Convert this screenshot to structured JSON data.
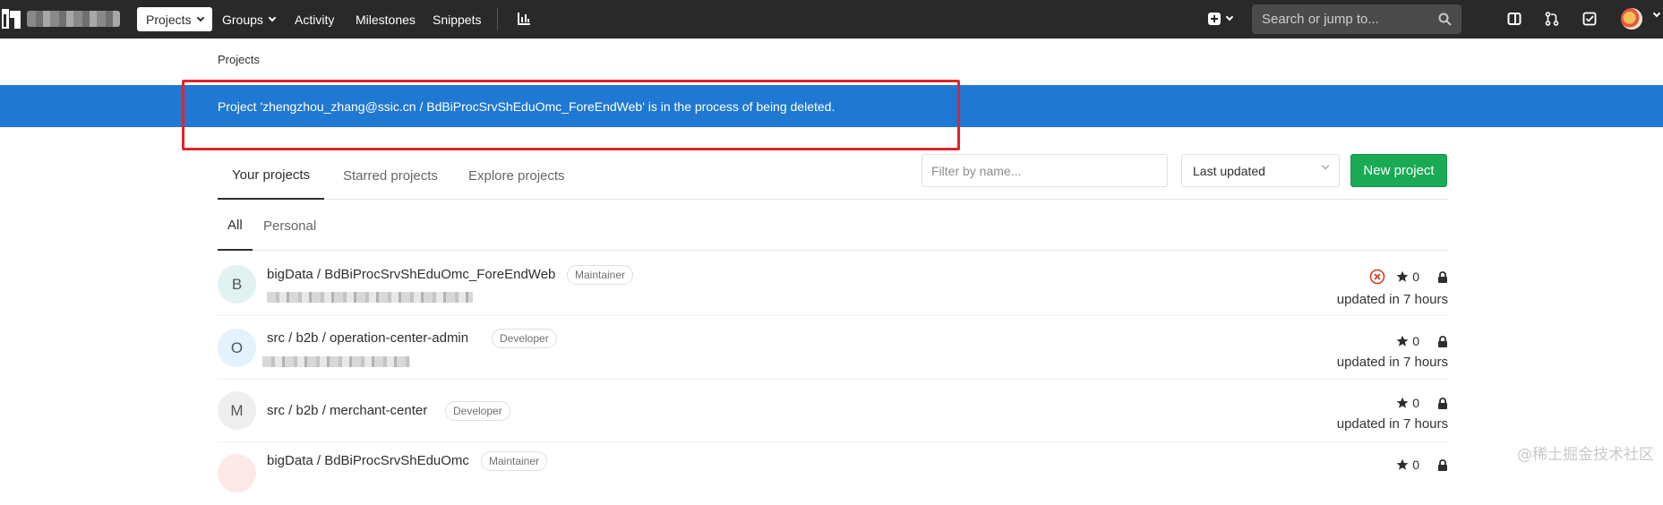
{
  "navbar": {
    "nav_items": [
      "Projects",
      "Groups",
      "Activity",
      "Milestones",
      "Snippets"
    ],
    "search_placeholder": "Search or jump to..."
  },
  "breadcrumb": "Projects",
  "flash_message": "Project 'zhengzhou_zhang@ssic.cn / BdBiProcSrvShEduOmc_ForeEndWeb' is in the process of being deleted.",
  "tabs": [
    "Your projects",
    "Starred projects",
    "Explore projects"
  ],
  "filter_placeholder": "Filter by name...",
  "sort_selected": "Last updated",
  "new_project_label": "New project",
  "subtabs": [
    "All",
    "Personal"
  ],
  "projects": [
    {
      "letter": "B",
      "name": "bigData / BdBiProcSrvShEduOmc_ForeEndWeb",
      "role": "Maintainer",
      "stars": "0",
      "updated": "updated in 7 hours",
      "pipeline_failed": true
    },
    {
      "letter": "O",
      "name": "src / b2b / operation-center-admin",
      "role": "Developer",
      "stars": "0",
      "updated": "updated in 7 hours",
      "pipeline_failed": false
    },
    {
      "letter": "M",
      "name": "src / b2b / merchant-center",
      "role": "Developer",
      "stars": "0",
      "updated": "updated in 7 hours",
      "pipeline_failed": false
    },
    {
      "letter": "",
      "name": "bigData / BdBiProcSrvShEduOmc",
      "role": "Maintainer",
      "stars": "0",
      "updated": "",
      "pipeline_failed": false
    }
  ],
  "watermark": "@稀土掘金技术社区",
  "colors": {
    "navbar": "#292929",
    "flash": "#1f78d1",
    "new_button": "#1aaa55",
    "highlight_box": "#e0252b"
  },
  "icons": [
    "plus-icon",
    "sidebar-icon",
    "merge-request-icon",
    "todo-icon",
    "chart-icon",
    "star-icon",
    "lock-icon",
    "pipeline-failed-icon",
    "search-icon"
  ]
}
